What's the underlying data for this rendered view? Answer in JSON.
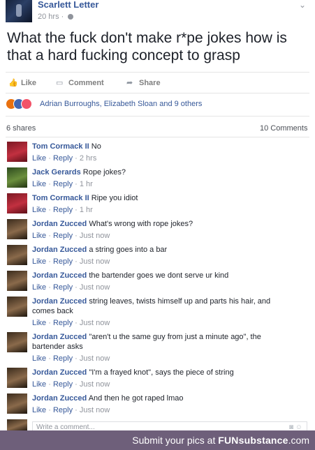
{
  "post": {
    "author": "Scarlett Letter",
    "time": "20 hrs",
    "text": "What the fuck don't make r*pe jokes how is that a hard fucking concept to grasp"
  },
  "actions": {
    "like": "Like",
    "comment": "Comment",
    "share": "Share"
  },
  "reactions": {
    "icons": [
      "angry-reaction",
      "like-reaction",
      "love-reaction"
    ],
    "names": "Adrian Burroughs, Elizabeth Sloan and 9 others"
  },
  "stats": {
    "shares": "6 shares",
    "comments": "10 Comments"
  },
  "comment_actions": {
    "like": "Like",
    "reply": "Reply"
  },
  "comments": [
    {
      "name": "Tom Cormack II",
      "text": "No",
      "time": "2 hrs"
    },
    {
      "name": "Jack Gerards",
      "text": "Rope jokes?",
      "time": "1 hr"
    },
    {
      "name": "Tom Cormack II",
      "text": "Ripe you idiot",
      "time": "1 hr"
    },
    {
      "name": "Jordan Zucced",
      "text": "What's wrong with rope jokes?",
      "time": "Just now"
    },
    {
      "name": "Jordan Zucced",
      "text": "a string goes into a bar",
      "time": "Just now"
    },
    {
      "name": "Jordan Zucced",
      "text": "the bartender goes we dont serve ur kind",
      "time": "Just now"
    },
    {
      "name": "Jordan Zucced",
      "text": "string leaves, twists himself up and parts his hair, and comes back",
      "time": "Just now"
    },
    {
      "name": "Jordan Zucced",
      "text": "\"aren't u the same guy from just a minute ago\", the bartender asks",
      "time": "Just now"
    },
    {
      "name": "Jordan Zucced",
      "text": "\"I'm a frayed knot\", says the piece of string",
      "time": "Just now"
    },
    {
      "name": "Jordan Zucced",
      "text": "And then he got raped lmao",
      "time": "Just now"
    }
  ],
  "composer": {
    "placeholder": "Write a comment..."
  },
  "footer": {
    "prefix": "Submit your pics at",
    "brand": "FUNsubstance",
    "suffix": ".com"
  }
}
